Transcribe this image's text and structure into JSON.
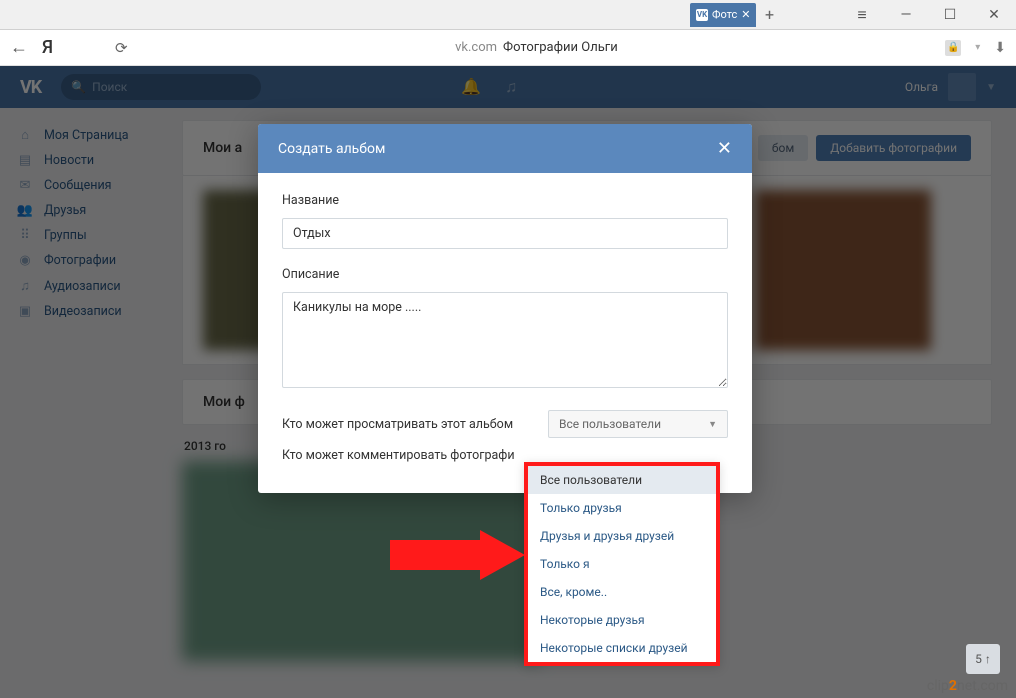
{
  "browser": {
    "tab_text": "Фотс",
    "tab_fav": "VK",
    "domain": "vk.com",
    "page_title": "Фотографии Ольги"
  },
  "vk": {
    "search_placeholder": "Поиск",
    "username": "Ольга"
  },
  "sidebar": {
    "items": [
      {
        "icon": "⌂",
        "label": "Моя Страница"
      },
      {
        "icon": "▤",
        "label": "Новости"
      },
      {
        "icon": "✉",
        "label": "Сообщения"
      },
      {
        "icon": "👥",
        "label": "Друзья"
      },
      {
        "icon": "⠿",
        "label": "Группы"
      },
      {
        "icon": "◉",
        "label": "Фотографии"
      },
      {
        "icon": "♫",
        "label": "Аудиозаписи"
      },
      {
        "icon": "▣",
        "label": "Видеозаписи"
      }
    ]
  },
  "content": {
    "my_photos": "Мои а",
    "my_photos2": "Мои ф",
    "create_album_btn": "бом",
    "add_photos_btn": "Добавить фотографии",
    "year": "2013 го"
  },
  "modal": {
    "title": "Создать альбом",
    "name_label": "Название",
    "name_value": "Отдых",
    "desc_label": "Описание",
    "desc_value": "Каникулы на море .....",
    "who_view": "Кто может просматривать этот альбом",
    "who_comment": "Кто может комментировать фотографи",
    "selected": "Все пользователи"
  },
  "dropdown": {
    "options": [
      "Все пользователи",
      "Только друзья",
      "Друзья и друзья друзей",
      "Только я",
      "Все, кроме..",
      "Некоторые друзья",
      "Некоторые списки друзей"
    ]
  },
  "watermark": {
    "pre": "clip",
    "mid": "2",
    "post": "net",
    "suffix": ".com"
  }
}
